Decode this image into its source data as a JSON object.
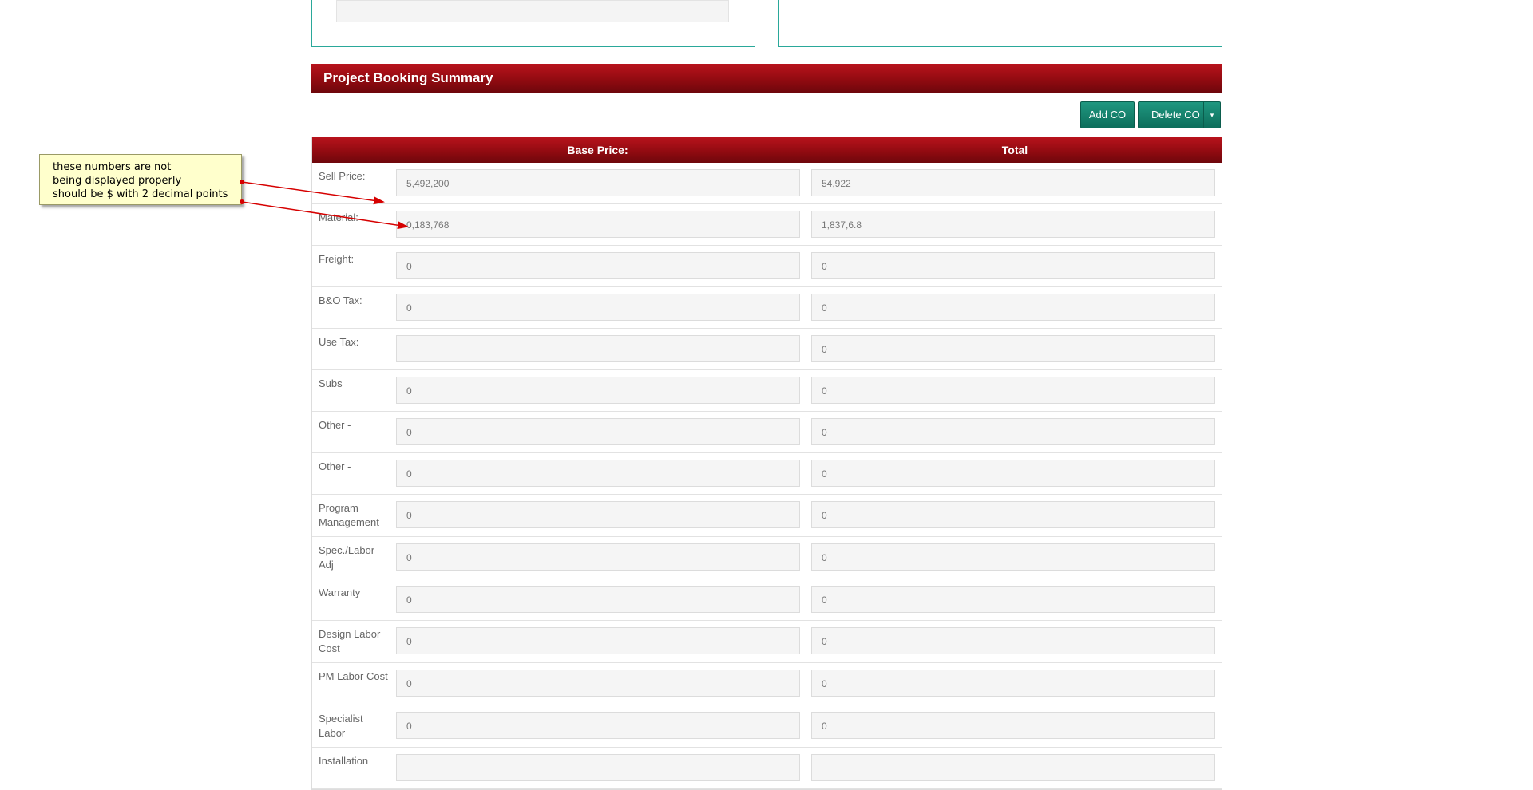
{
  "section": {
    "title": "Project Booking Summary"
  },
  "buttons": {
    "add_co": "Add CO",
    "delete_co": "Delete CO",
    "caret": "▾"
  },
  "table": {
    "headers": {
      "base": "Base Price:",
      "total": "Total"
    },
    "rows": [
      {
        "label": "Sell Price:",
        "base": "5,492,200",
        "total": "54,922"
      },
      {
        "label": "Material:",
        "base": "0,183,768",
        "total": "1,837,6.8"
      },
      {
        "label": "Freight:",
        "base": "0",
        "total": "0"
      },
      {
        "label": "B&O Tax:",
        "base": "0",
        "total": "0"
      },
      {
        "label": "Use Tax:",
        "base": "",
        "total": "0"
      },
      {
        "label": "Subs",
        "base": "0",
        "total": "0"
      },
      {
        "label": "Other -",
        "base": "0",
        "total": "0"
      },
      {
        "label": "Other -",
        "base": "0",
        "total": "0"
      },
      {
        "label": "Program Management",
        "base": "0",
        "total": "0"
      },
      {
        "label": "Spec./Labor Adj",
        "base": "0",
        "total": "0"
      },
      {
        "label": "Warranty",
        "base": "0",
        "total": "0"
      },
      {
        "label": "Design Labor Cost",
        "base": "0",
        "total": "0"
      },
      {
        "label": "PM Labor Cost",
        "base": "0",
        "total": "0"
      },
      {
        "label": "Specialist Labor",
        "base": "0",
        "total": "0"
      },
      {
        "label": "Installation",
        "base": "",
        "total": ""
      }
    ]
  },
  "annotation": {
    "lines": [
      "these numbers are not",
      "being displayed properly",
      "should be $ with 2 decimal points"
    ]
  },
  "colors": {
    "header_red": "#8e0a10",
    "button_teal": "#11755f",
    "panel_border": "#2aa89a",
    "note_yellow": "#ffffcc",
    "arrow_red": "#d60000"
  }
}
